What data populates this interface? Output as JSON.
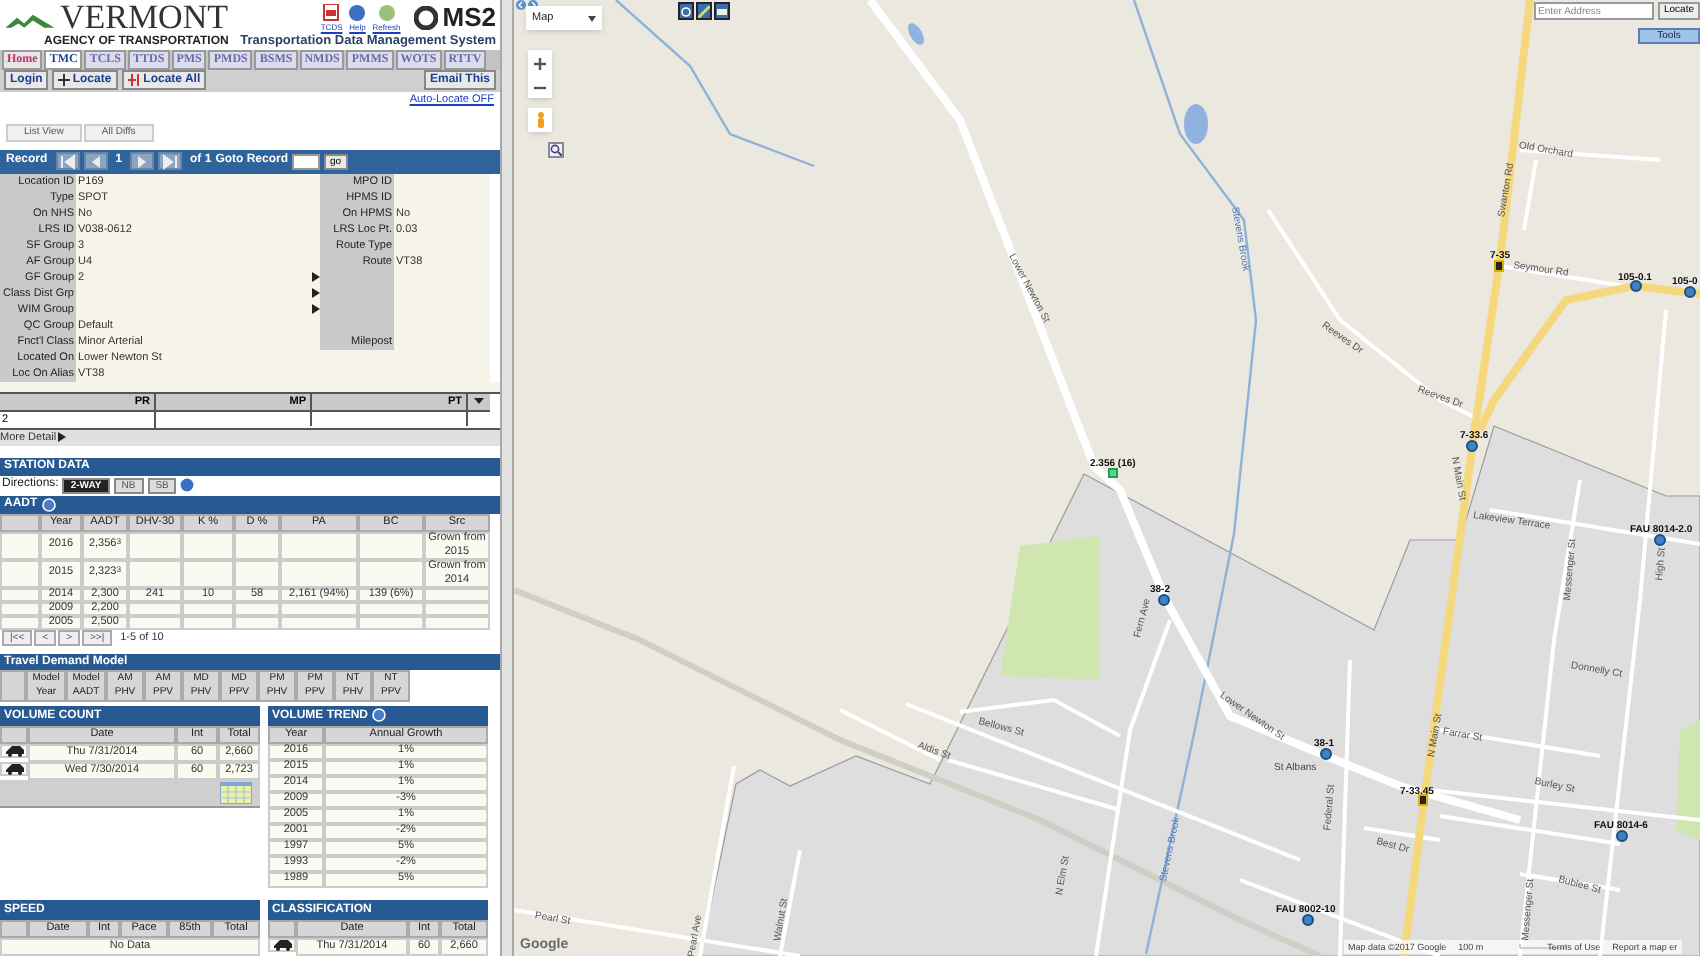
{
  "header": {
    "agency_name": "VERMONT",
    "agency_subtitle": "AGENCY OF TRANSPORTATION",
    "quick_links": [
      "TCDS",
      "Help",
      "Refresh"
    ],
    "product_logo": "MS2",
    "product_title": "Transportation Data Management System"
  },
  "module_tabs": [
    {
      "label": "Home",
      "selected": false,
      "disabled": false
    },
    {
      "label": "TMC",
      "selected": true,
      "disabled": false
    },
    {
      "label": "TCLS",
      "selected": false,
      "disabled": true
    },
    {
      "label": "TTDS",
      "selected": false,
      "disabled": true
    },
    {
      "label": "PMS",
      "selected": false,
      "disabled": true
    },
    {
      "label": "PMDS",
      "selected": false,
      "disabled": true
    },
    {
      "label": "BSMS",
      "selected": false,
      "disabled": true
    },
    {
      "label": "NMDS",
      "selected": false,
      "disabled": true
    },
    {
      "label": "PMMS",
      "selected": false,
      "disabled": true
    },
    {
      "label": "WOTS",
      "selected": false,
      "disabled": true
    },
    {
      "label": "RTTV",
      "selected": false,
      "disabled": true
    }
  ],
  "toolbar": {
    "buttons": [
      {
        "label": "Login",
        "kind": "plain"
      },
      {
        "label": "Locate",
        "kind": "locate"
      },
      {
        "label": "Locate All",
        "kind": "locate-all"
      }
    ],
    "email": "Email This",
    "auto_locate": "Auto-Locate OFF"
  },
  "view_tabs": [
    "List View",
    "All Diffs"
  ],
  "record_nav": {
    "label": "Record",
    "current": "1",
    "of": "of 1",
    "goto_label": "Goto Record",
    "go": "go"
  },
  "location_fields": [
    {
      "kind": "pair",
      "label": "Location ID",
      "value": "P169",
      "right_label": "MPO ID"
    },
    {
      "kind": "pair",
      "label": "Type",
      "value": "SPOT",
      "right_label": "HPMS ID"
    },
    {
      "kind": "pair",
      "label": "On NHS",
      "value": "No",
      "right_label": "On HPMS",
      "right_value": "No"
    },
    {
      "kind": "pair",
      "label": "LRS ID",
      "value": "V038-0612",
      "right_label": "LRS Loc Pt.",
      "right_value": "0.03"
    },
    {
      "kind": "pair",
      "label": "SF Group",
      "value": "3",
      "right_label": "Route Type"
    },
    {
      "kind": "pair",
      "label": "AF Group",
      "value": "U4",
      "right_label": "Route",
      "right_value": "VT38"
    },
    {
      "kind": "pair",
      "label": "GF Group",
      "value": "2",
      "expandable": true
    },
    {
      "kind": "pair",
      "label": "Class Dist Grp",
      "expandable": true
    },
    {
      "kind": "pair",
      "label": "WIM Group",
      "expandable": true
    },
    {
      "kind": "pair",
      "label": "QC Group",
      "value": "Default"
    },
    {
      "kind": "pair",
      "label": "Fnct'l Class",
      "value": "Minor Arterial",
      "right_label": "Milepost"
    },
    {
      "kind": "wide",
      "label": "Located On",
      "value": "Lower Newton St"
    },
    {
      "kind": "wide",
      "label": "Loc On Alias",
      "value": "VT38"
    }
  ],
  "mp_table": {
    "columns": [
      "PR",
      "MP",
      "PT"
    ],
    "rows": [
      {
        "pr": "2"
      }
    ]
  },
  "more_detail": "More Detail",
  "station_data": {
    "title": "STATION DATA",
    "directions_label": "Directions:",
    "directions": [
      {
        "label": "2-WAY",
        "selected": true
      },
      {
        "label": "NB",
        "selected": false
      },
      {
        "label": "SB",
        "selected": false
      }
    ]
  },
  "aadt": {
    "title": "AADT",
    "columns": [
      "Year",
      "AADT",
      "DHV-30",
      "K %",
      "D %",
      "PA",
      "BC",
      "Src"
    ],
    "rows": [
      {
        "year": "2016",
        "aadt": "2,356$^{3}$",
        "src": "Grown from 2015"
      },
      {
        "year": "2015",
        "aadt": "2,323$^{3}$",
        "src": "Grown from 2014"
      },
      {
        "year": "2014",
        "aadt": "2,300",
        "dhv": "241",
        "k": "10",
        "d": "58",
        "pa": "2,161 (94%)",
        "bc": "139 (6%)"
      },
      {
        "year": "2009",
        "aadt": "2,200"
      },
      {
        "year": "2005",
        "aadt": "2,500"
      }
    ],
    "pager": [
      "|<<",
      "<",
      ">",
      ">>|"
    ],
    "range": "1-5 of 10"
  },
  "travel_demand_model": {
    "title": "Travel Demand Model",
    "columns": [
      "Model Year",
      "Model AADT",
      "AM PHV",
      "AM PPV",
      "MD PHV",
      "MD PPV",
      "PM PHV",
      "PM PPV",
      "NT PHV",
      "NT PPV"
    ]
  },
  "volume_count": {
    "title": "VOLUME COUNT",
    "columns": [
      "Date",
      "Int",
      "Total"
    ],
    "rows": [
      {
        "date": "Thu 7/31/2014",
        "int": "60",
        "total": "2,660"
      },
      {
        "date": "Wed 7/30/2014",
        "int": "60",
        "total": "2,723"
      }
    ]
  },
  "volume_trend": {
    "title": "VOLUME TREND",
    "columns": [
      "Year",
      "Annual Growth"
    ],
    "rows": [
      [
        "2016",
        "1%"
      ],
      [
        "2015",
        "1%"
      ],
      [
        "2014",
        "1%"
      ],
      [
        "2009",
        "-3%"
      ],
      [
        "2005",
        "1%"
      ],
      [
        "2001",
        "-2%"
      ],
      [
        "1997",
        "5%"
      ],
      [
        "1993",
        "-2%"
      ],
      [
        "1989",
        "5%"
      ]
    ]
  },
  "speed": {
    "title": "SPEED",
    "columns": [
      "Date",
      "Int",
      "Pace",
      "85th",
      "Total"
    ],
    "empty_text": "No Data"
  },
  "classification": {
    "title": "CLASSIFICATION",
    "columns": [
      "Date",
      "Int",
      "Total"
    ],
    "rows": [
      {
        "date": "Thu 7/31/2014",
        "int": "60",
        "total": "2,660"
      }
    ]
  },
  "map": {
    "map_type": "Map",
    "address_placeholder": "Enter Address",
    "locate": "Locate",
    "tools": "Tools",
    "markers": [
      {
        "label": "2.356 (16)",
        "kind": "count"
      },
      {
        "label": "38-2",
        "kind": "station"
      },
      {
        "label": "38-1",
        "kind": "station"
      },
      {
        "label": "7-33.45",
        "kind": "continuous"
      },
      {
        "label": "7-35",
        "kind": "continuous"
      },
      {
        "label": "7-33.6",
        "kind": "station"
      },
      {
        "label": "105-0.1",
        "kind": "station"
      },
      {
        "label": "105-0",
        "kind": "station"
      },
      {
        "label": "FAU 8014-2.0",
        "kind": "station"
      },
      {
        "label": "FAU 8014-6",
        "kind": "station"
      },
      {
        "label": "FAU 8002-10",
        "kind": "station"
      }
    ],
    "labels": [
      {
        "text": "Lower Newton St",
        "kind": "street"
      },
      {
        "text": "Lower Newton St",
        "kind": "street"
      },
      {
        "text": "Swanton Rd",
        "kind": "street"
      },
      {
        "text": "Old Orchard",
        "kind": "street"
      },
      {
        "text": "Seymour Rd",
        "kind": "street"
      },
      {
        "text": "Reeves Dr",
        "kind": "street"
      },
      {
        "text": "Reeves Dr",
        "kind": "street"
      },
      {
        "text": "Stevens Brook",
        "kind": "water"
      },
      {
        "text": "Stevens Brook",
        "kind": "water"
      },
      {
        "text": "N Main St",
        "kind": "street"
      },
      {
        "text": "N Main St",
        "kind": "street"
      },
      {
        "text": "Lakeview Terrace",
        "kind": "street"
      },
      {
        "text": "Messenger St",
        "kind": "street"
      },
      {
        "text": "Messenger St",
        "kind": "street"
      },
      {
        "text": "Donnelly Ct",
        "kind": "street"
      },
      {
        "text": "Farrar St",
        "kind": "street"
      },
      {
        "text": "Burley St",
        "kind": "street"
      },
      {
        "text": "Best Dr",
        "kind": "street"
      },
      {
        "text": "Bublee St",
        "kind": "street"
      },
      {
        "text": "High St",
        "kind": "street"
      },
      {
        "text": "Fern Ave",
        "kind": "street"
      },
      {
        "text": "Bellows St",
        "kind": "street"
      },
      {
        "text": "Aldis St",
        "kind": "street"
      },
      {
        "text": "N Elm St",
        "kind": "street"
      },
      {
        "text": "Pearl St",
        "kind": "street"
      },
      {
        "text": "Pearl Ave",
        "kind": "street"
      },
      {
        "text": "Walnut St",
        "kind": "street"
      },
      {
        "text": "St Albans",
        "kind": "place"
      },
      {
        "text": "Federal St",
        "kind": "street"
      }
    ],
    "logo": "Google",
    "attribution": "Map data ©2017 Google",
    "scale": "100 m",
    "terms": "Terms of Use",
    "report": "Report a map er"
  }
}
